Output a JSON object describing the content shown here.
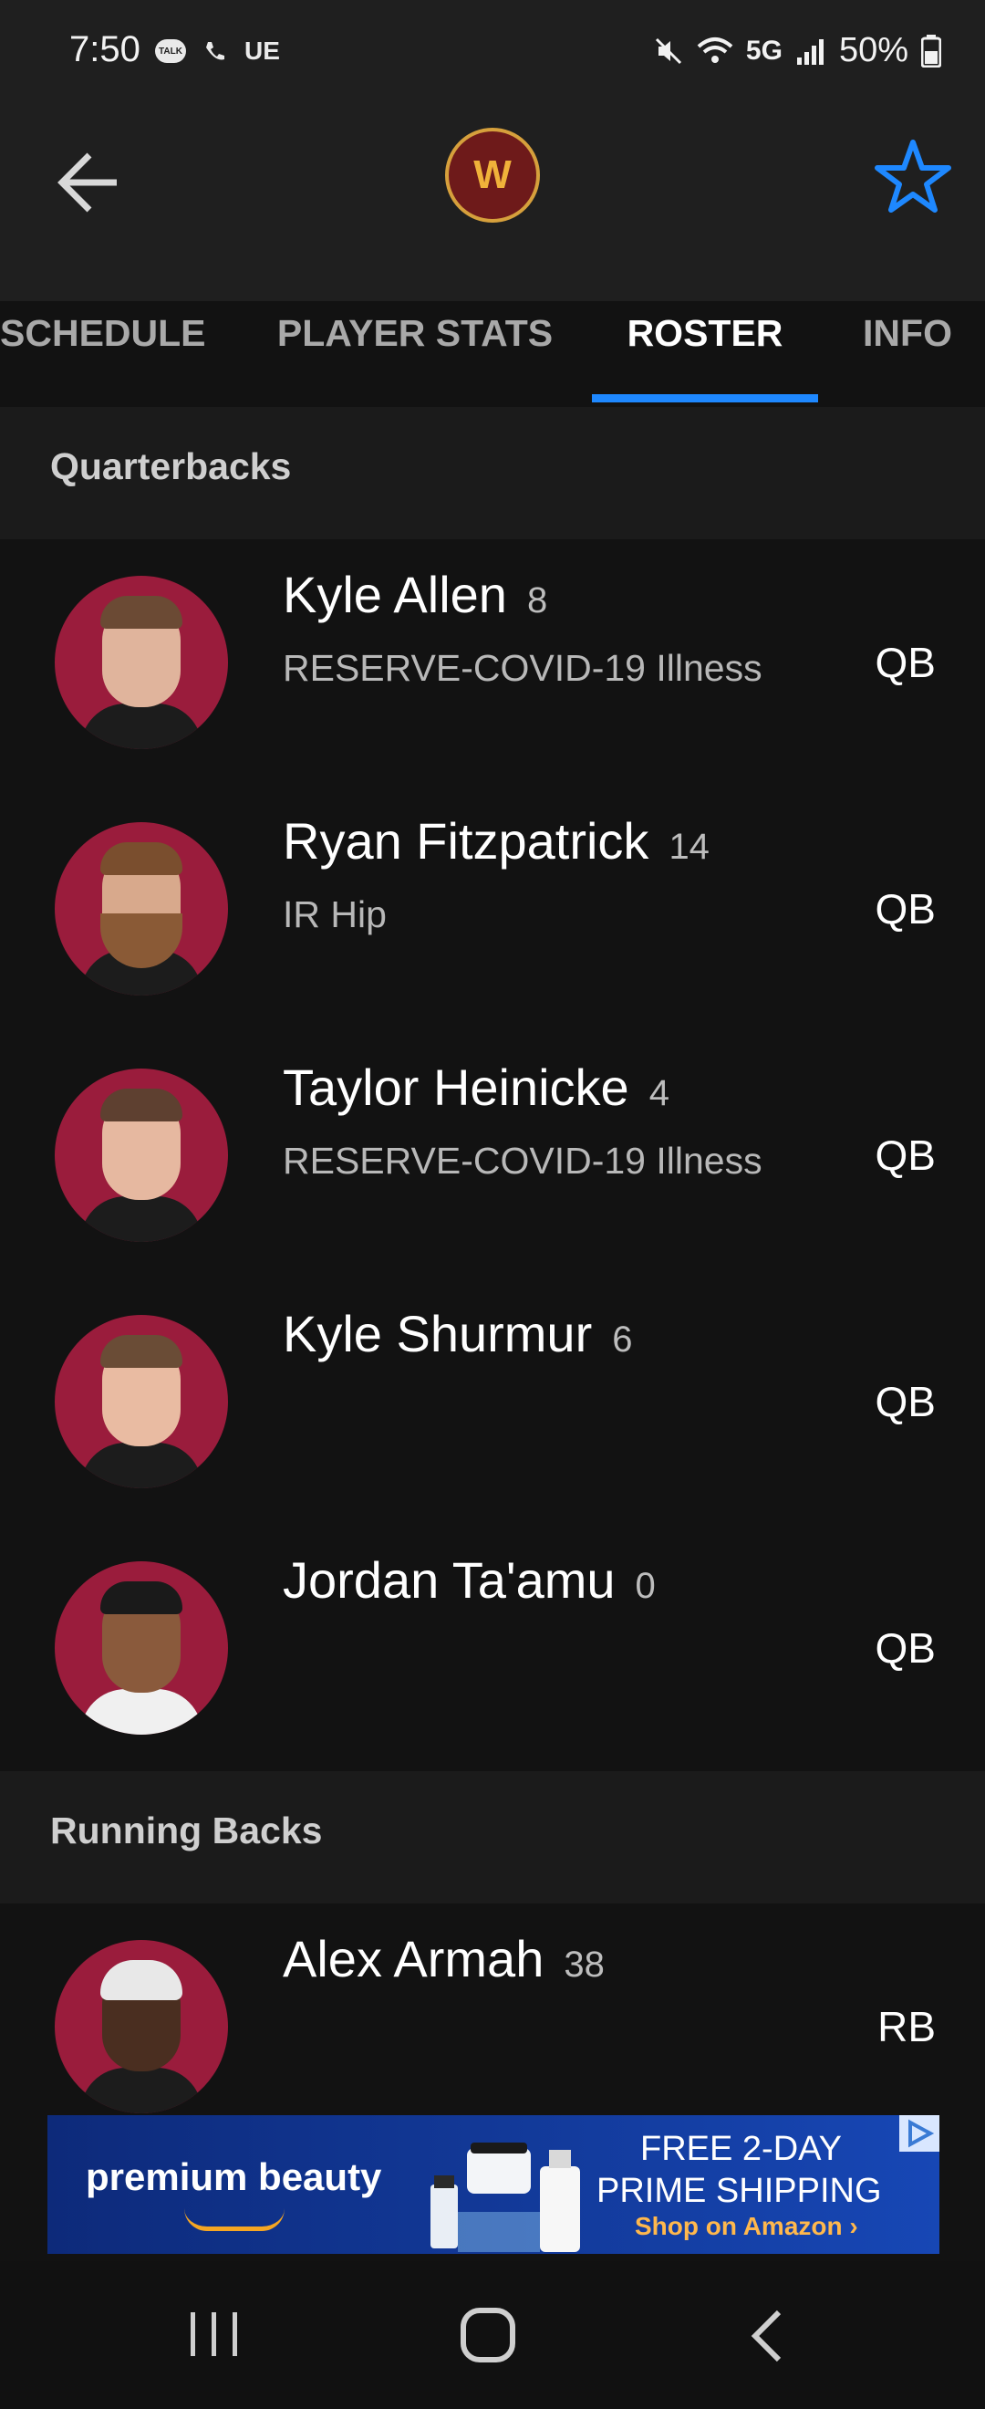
{
  "status_bar": {
    "time": "7:50",
    "talk": "TALK",
    "carrier": "UE",
    "network": "5G",
    "battery": "50%"
  },
  "app_bar": {
    "logo_text": "W",
    "colors": {
      "accent": "#1e88ff",
      "avatar_bg": "#9a1c3c"
    }
  },
  "tabs": [
    "SCHEDULE",
    "PLAYER STATS",
    "ROSTER",
    "INFO"
  ],
  "sections": [
    {
      "title": "Quarterbacks",
      "players": [
        {
          "name": "Kyle Allen",
          "number": "8",
          "status": "RESERVE-COVID-19 Illness",
          "position": "QB"
        },
        {
          "name": "Ryan Fitzpatrick",
          "number": "14",
          "status": "IR Hip",
          "position": "QB"
        },
        {
          "name": "Taylor Heinicke",
          "number": "4",
          "status": "RESERVE-COVID-19 Illness",
          "position": "QB"
        },
        {
          "name": "Kyle Shurmur",
          "number": "6",
          "status": "",
          "position": "QB"
        },
        {
          "name": "Jordan Ta'amu",
          "number": "0",
          "status": "",
          "position": "QB"
        }
      ]
    },
    {
      "title": "Running Backs",
      "players": [
        {
          "name": "Alex Armah",
          "number": "38",
          "status": "",
          "position": "RB"
        }
      ]
    }
  ],
  "ad": {
    "brand": "premium beauty",
    "promo_line1": "FREE 2-DAY",
    "promo_line2": "PRIME SHIPPING",
    "cta": "Shop on Amazon ›"
  }
}
